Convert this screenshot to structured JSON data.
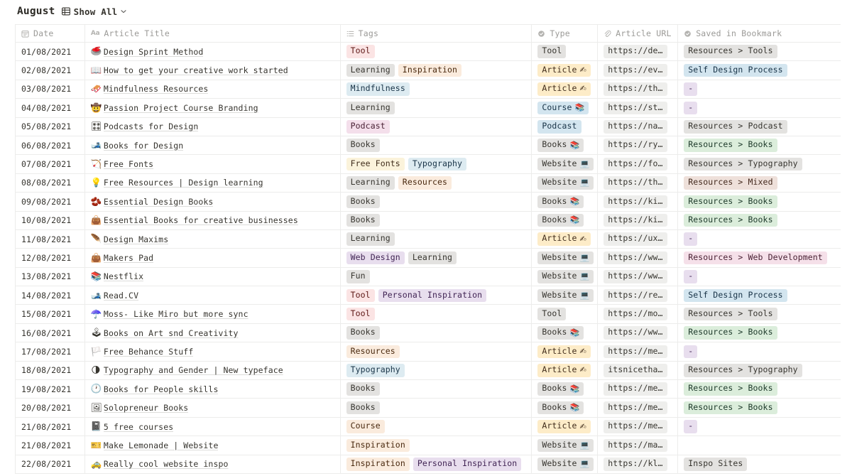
{
  "header": {
    "title": "August",
    "view_icon": "table-grid-icon",
    "view_label": "Show All",
    "chevron": "chevron-down-icon"
  },
  "table": {
    "columns": [
      {
        "key": "date",
        "label": "Date",
        "icon": "calendar-icon"
      },
      {
        "key": "title",
        "label": "Article Title",
        "icon": "aa-text-icon"
      },
      {
        "key": "tags",
        "label": "Tags",
        "icon": "multiselect-list-icon"
      },
      {
        "key": "type",
        "label": "Type",
        "icon": "select-circle-icon"
      },
      {
        "key": "url",
        "label": "Article URL",
        "icon": "link-paperclip-icon"
      },
      {
        "key": "book",
        "label": "Saved in Bookmark",
        "icon": "select-circle-icon"
      }
    ],
    "tag_colors": {
      "Tool": {
        "bg": "#fbe4e4",
        "fg": "#5d1715"
      },
      "Learning": {
        "bg": "#e3e2e0",
        "fg": "#37352f"
      },
      "Inspiration": {
        "bg": "#faebdd",
        "fg": "#49290f"
      },
      "Mindfulness": {
        "bg": "#ddebf1",
        "fg": "#183347"
      },
      "Podcast": {
        "bg": "#f4dfeb",
        "fg": "#4a2235"
      },
      "Books": {
        "bg": "#e3e2e0",
        "fg": "#37352f"
      },
      "Free Fonts": {
        "bg": "#fbf3db",
        "fg": "#402c1b"
      },
      "Typography": {
        "bg": "#ddebf1",
        "fg": "#183347"
      },
      "Resources": {
        "bg": "#faebdd",
        "fg": "#49290f"
      },
      "Web Design": {
        "bg": "#e8deee",
        "fg": "#412454"
      },
      "Fun": {
        "bg": "#e3e2e0",
        "fg": "#37352f"
      },
      "Personal Inspiration": {
        "bg": "#e8deee",
        "fg": "#412454"
      },
      "Course": {
        "bg": "#faebdd",
        "fg": "#49290f"
      }
    },
    "type_colors": {
      "Tool": {
        "bg": "#e3e2e0",
        "fg": "#37352f"
      },
      "Article": {
        "bg": "#fdecc8",
        "fg": "#402c1b"
      },
      "Course": {
        "bg": "#d3e5ef",
        "fg": "#183347"
      },
      "Podcast": {
        "bg": "#d3e5ef",
        "fg": "#183347"
      },
      "Books": {
        "bg": "#e3e2e0",
        "fg": "#37352f"
      },
      "Website": {
        "bg": "#e3e2e0",
        "fg": "#37352f"
      }
    },
    "bookmark_colors": {
      "Resources > Tools": {
        "bg": "#e3e2e0",
        "fg": "#37352f"
      },
      "Self Design Process": {
        "bg": "#d3e5ef",
        "fg": "#183347"
      },
      "-": {
        "bg": "#e8deee",
        "fg": "#412454"
      },
      "Resources > Podcast": {
        "bg": "#e3e2e0",
        "fg": "#37352f"
      },
      "Resources > Books": {
        "bg": "#dbeddb",
        "fg": "#1c3829"
      },
      "Resources > Typography": {
        "bg": "#e3e2e0",
        "fg": "#37352f"
      },
      "Resources > Mixed": {
        "bg": "#eee0da",
        "fg": "#442a1e"
      },
      "Resources > Web Development": {
        "bg": "#f5e0e9",
        "fg": "#4a2235"
      },
      "Inspo Sites": {
        "bg": "#e3e2e0",
        "fg": "#37352f"
      }
    },
    "rows": [
      {
        "date": "01/08/2021",
        "emoji": "🥌",
        "emoji_name": "curling-stone-icon",
        "title": "Design Sprint Method",
        "tags": [
          "Tool"
        ],
        "type": "Tool",
        "type_emoji": "",
        "url": "https://de…",
        "book": "Resources > Tools"
      },
      {
        "date": "02/08/2021",
        "emoji": "📖",
        "emoji_name": "open-book-icon",
        "title": "How to get your creative work started",
        "tags": [
          "Learning",
          "Inspiration"
        ],
        "type": "Article",
        "type_emoji": "✍",
        "url": "https://ev…",
        "book": "Self Design Process"
      },
      {
        "date": "03/08/2021",
        "emoji": "🛷",
        "emoji_name": "sled-icon",
        "title": "Mindfulness Resources",
        "tags": [
          "Mindfulness"
        ],
        "type": "Article",
        "type_emoji": "✍",
        "url": "https://th…",
        "book": "-"
      },
      {
        "date": "04/08/2021",
        "emoji": "🤠",
        "emoji_name": "cowboy-hat-face-icon",
        "title": "Passion Project Course Branding",
        "tags": [
          "Learning"
        ],
        "type": "Course",
        "type_emoji": "📚",
        "url": "https://st…",
        "book": "-"
      },
      {
        "date": "05/08/2021",
        "emoji": "🎛",
        "emoji_name": "control-knobs-icon",
        "title": "Podcasts for Design",
        "tags": [
          "Podcast"
        ],
        "type": "Podcast",
        "type_emoji": "",
        "url": "https://na…",
        "book": "Resources > Podcast"
      },
      {
        "date": "06/08/2021",
        "emoji": "🎿",
        "emoji_name": "water-ski-icon",
        "title": "Books for Design",
        "tags": [
          "Books"
        ],
        "type": "Books",
        "type_emoji": "📚",
        "url": "https://ry…",
        "book": "Resources > Books"
      },
      {
        "date": "07/08/2021",
        "emoji": "🏹",
        "emoji_name": "bow-and-arrow-icon",
        "title": "Free Fonts",
        "tags": [
          "Free Fonts",
          "Typography"
        ],
        "type": "Website",
        "type_emoji": "💻",
        "url": "https://fo…",
        "book": "Resources > Typography"
      },
      {
        "date": "08/08/2021",
        "emoji": "💡",
        "emoji_name": "light-bulb-icon",
        "title": "Free Resources | Design learning",
        "tags": [
          "Learning",
          "Resources"
        ],
        "type": "Website",
        "type_emoji": "💻",
        "url": "https://th…",
        "book": "Resources > Mixed"
      },
      {
        "date": "09/08/2021",
        "emoji": "🫘",
        "emoji_name": "coffee-bean-icon",
        "title": "Essential Design Books",
        "tags": [
          "Books"
        ],
        "type": "Books",
        "type_emoji": "📚",
        "url": "https://ki…",
        "book": "Resources > Books"
      },
      {
        "date": "10/08/2021",
        "emoji": "👜",
        "emoji_name": "handbag-icon",
        "title": "Essential Books for creative businesses",
        "tags": [
          "Books"
        ],
        "type": "Books",
        "type_emoji": "📚",
        "url": "https://ki…",
        "book": "Resources > Books"
      },
      {
        "date": "11/08/2021",
        "emoji": "🪶",
        "emoji_name": "feather-icon",
        "title": "Design Maxims",
        "tags": [
          "Learning"
        ],
        "type": "Article",
        "type_emoji": "✍",
        "url": "https://ux…",
        "book": "-"
      },
      {
        "date": "12/08/2021",
        "emoji": "👜",
        "emoji_name": "handbag-icon",
        "title": "Makers Pad",
        "tags": [
          "Web Design",
          "Learning"
        ],
        "type": "Website",
        "type_emoji": "💻",
        "url": "https://ww…",
        "book": "Resources > Web Development"
      },
      {
        "date": "13/08/2021",
        "emoji": "📚",
        "emoji_name": "books-icon",
        "title": "Nestflix",
        "tags": [
          "Fun"
        ],
        "type": "Website",
        "type_emoji": "💻",
        "url": "https://ww…",
        "book": "-"
      },
      {
        "date": "14/08/2021",
        "emoji": "🎿",
        "emoji_name": "water-ski-icon",
        "title": "Read.CV",
        "tags": [
          "Tool",
          "Personal Inspiration"
        ],
        "type": "Website",
        "type_emoji": "💻",
        "url": "https://re…",
        "book": "Self Design Process"
      },
      {
        "date": "15/08/2021",
        "emoji": "☂️",
        "emoji_name": "umbrella-icon",
        "title": "Moss- Like Miro but more sync",
        "tags": [
          "Tool"
        ],
        "type": "Tool",
        "type_emoji": "",
        "url": "https://mo…",
        "book": "Resources > Tools"
      },
      {
        "date": "16/08/2021",
        "emoji": "🕹",
        "emoji_name": "joystick-icon",
        "title": "Books on Art snd Creativity",
        "tags": [
          "Books"
        ],
        "type": "Books",
        "type_emoji": "📚",
        "url": "https://ww…",
        "book": "Resources > Books"
      },
      {
        "date": "17/08/2021",
        "emoji": "🏳️",
        "emoji_name": "white-flag-icon",
        "title": "Free Behance Stuff",
        "tags": [
          "Resources"
        ],
        "type": "Article",
        "type_emoji": "✍",
        "url": "https://me…",
        "book": "-"
      },
      {
        "date": "18/08/2021",
        "emoji": "🌗",
        "emoji_name": "last-quarter-moon-icon",
        "title": "Typography and Gender | New typeface",
        "tags": [
          "Typography"
        ],
        "type": "Article",
        "type_emoji": "✍",
        "url": "itsnicetha…",
        "book": "Resources > Typography"
      },
      {
        "date": "19/08/2021",
        "emoji": "🕐",
        "emoji_name": "clock-icon",
        "title": "Books for People skills",
        "tags": [
          "Books"
        ],
        "type": "Books",
        "type_emoji": "📚",
        "url": "https://me…",
        "book": "Resources > Books"
      },
      {
        "date": "20/08/2021",
        "emoji": "🖼",
        "emoji_name": "framed-picture-icon",
        "title": "Solopreneur Books",
        "tags": [
          "Books"
        ],
        "type": "Books",
        "type_emoji": "📚",
        "url": "https://me…",
        "book": "Resources > Books"
      },
      {
        "date": "21/08/2021",
        "emoji": "📓",
        "emoji_name": "notebook-icon",
        "title": "5 free courses",
        "tags": [
          "Course"
        ],
        "type": "Article",
        "type_emoji": "✍",
        "url": "https://me…",
        "book": "-"
      },
      {
        "date": "21/08/2021",
        "emoji": "🎫",
        "emoji_name": "ticket-icon",
        "title": "Make Lemonade | Website",
        "tags": [
          "Inspiration"
        ],
        "type": "Website",
        "type_emoji": "💻",
        "url": "https://ma…",
        "book": ""
      },
      {
        "date": "22/08/2021",
        "emoji": "🚕",
        "emoji_name": "taxi-icon",
        "title": "Really cool website inspo",
        "tags": [
          "Inspiration",
          "Personal Inspiration"
        ],
        "type": "Website",
        "type_emoji": "💻",
        "url": "https://kl…",
        "book": "Inspo Sites"
      }
    ]
  }
}
